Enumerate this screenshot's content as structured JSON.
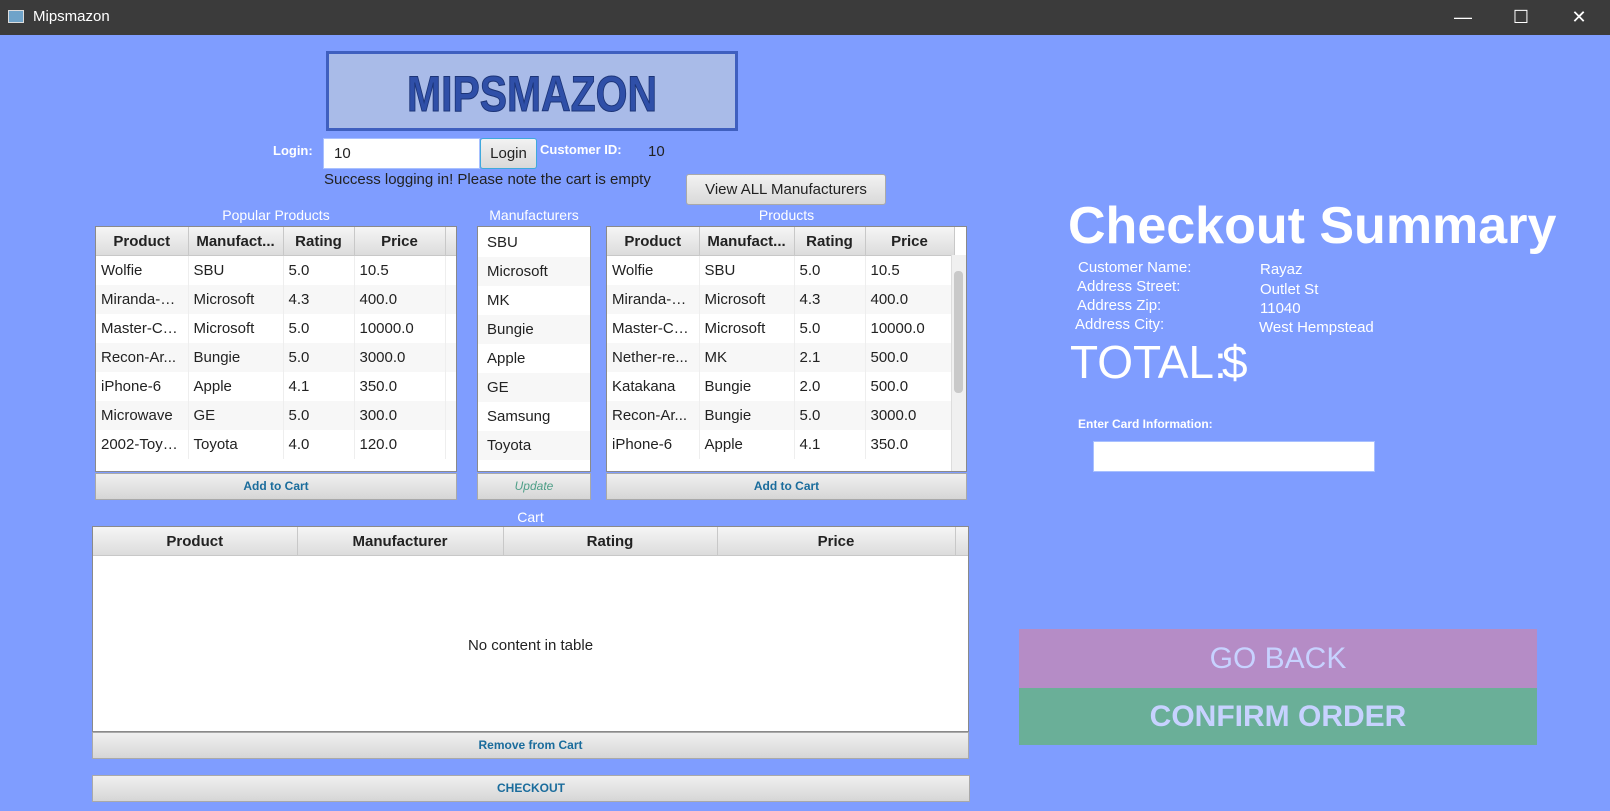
{
  "window": {
    "title": "Mipsmazon",
    "minimize_glyph": "—",
    "maximize_glyph": "☐",
    "close_glyph": "✕"
  },
  "logo": {
    "text": "MIPSMAZON"
  },
  "login": {
    "label": "Login:",
    "value": "10",
    "button": "Login",
    "customer_id_label": "Customer ID:",
    "customer_id_value": "10",
    "message": "Success logging in! Please note the cart is empty"
  },
  "view_all_manufacturers_button": "View ALL Manufacturers",
  "popular": {
    "label": "Popular Products",
    "columns": [
      "Product",
      "Manufact...",
      "Rating",
      "Price"
    ],
    "rows": [
      [
        "Wolfie",
        "SBU",
        "5.0",
        "10.5"
      ],
      [
        "Miranda-Li...",
        "Microsoft",
        "4.3",
        "400.0"
      ],
      [
        "Master-Ch...",
        "Microsoft",
        "5.0",
        "10000.0"
      ],
      [
        "Recon-Ar...",
        "Bungie",
        "5.0",
        "3000.0"
      ],
      [
        "iPhone-6",
        "Apple",
        "4.1",
        "350.0"
      ],
      [
        "Microwave",
        "GE",
        "5.0",
        "300.0"
      ],
      [
        "2002-Toyo...",
        "Toyota",
        "4.0",
        "120.0"
      ]
    ],
    "button": "Add to Cart"
  },
  "manufacturers": {
    "label": "Manufacturers",
    "items": [
      "SBU",
      "Microsoft",
      "MK",
      "Bungie",
      "Apple",
      "GE",
      "Samsung",
      "Toyota"
    ],
    "button": "Update"
  },
  "products": {
    "label": "Products",
    "columns": [
      "Product",
      "Manufact...",
      "Rating",
      "Price"
    ],
    "rows": [
      [
        "Wolfie",
        "SBU",
        "5.0",
        "10.5"
      ],
      [
        "Miranda-Li...",
        "Microsoft",
        "4.3",
        "400.0"
      ],
      [
        "Master-Ch...",
        "Microsoft",
        "5.0",
        "10000.0"
      ],
      [
        "Nether-re...",
        "MK",
        "2.1",
        "500.0"
      ],
      [
        "Katakana",
        "Bungie",
        "2.0",
        "500.0"
      ],
      [
        "Recon-Ar...",
        "Bungie",
        "5.0",
        "3000.0"
      ],
      [
        "iPhone-6",
        "Apple",
        "4.1",
        "350.0"
      ]
    ],
    "button": "Add to Cart"
  },
  "cart": {
    "label": "Cart",
    "columns": [
      "Product",
      "Manufacturer",
      "Rating",
      "Price"
    ],
    "empty_message": "No content in table",
    "remove_button": "Remove from Cart"
  },
  "checkout_button": "CHECKOUT",
  "summary": {
    "title": "Checkout Summary",
    "fields": [
      {
        "label": "Customer Name:",
        "value": "Rayaz"
      },
      {
        "label": "Address Street:",
        "value": "Outlet St"
      },
      {
        "label": "Address Zip:",
        "value": "11040"
      },
      {
        "label": "Address City:",
        "value": "West Hempstead"
      }
    ],
    "total_label": "TOTAL:",
    "total_currency": "$",
    "card_label": "Enter Card Information:",
    "card_value": ""
  },
  "go_back_button": "GO BACK",
  "confirm_button": "CONFIRM ORDER",
  "colors": {
    "background": "#7f9dff",
    "go_back": "#b58cc6",
    "confirm": "#6aaf98",
    "link_blue": "#1a6c9c"
  }
}
